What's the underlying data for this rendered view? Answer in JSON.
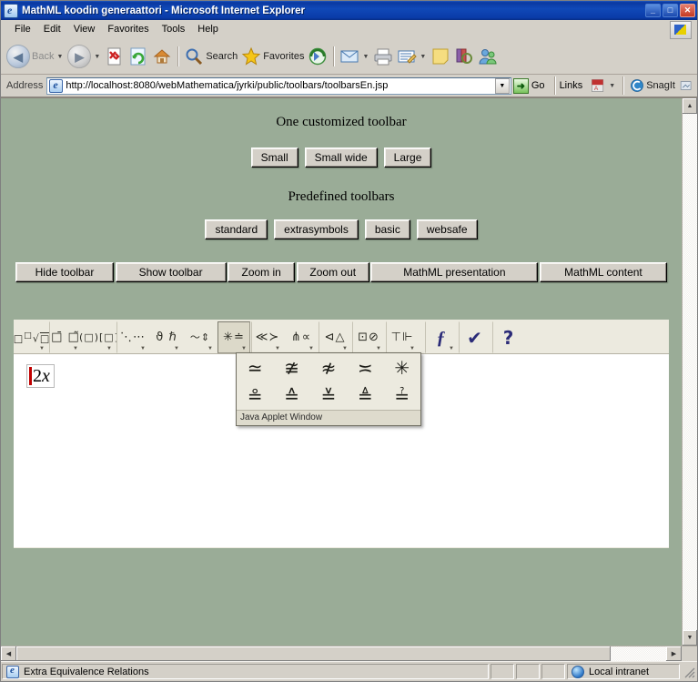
{
  "window": {
    "title": "MathML koodin generaattori - Microsoft Internet Explorer",
    "minimize_label": "_",
    "maximize_label": "□",
    "close_label": "✕"
  },
  "menu": {
    "items": [
      "File",
      "Edit",
      "View",
      "Favorites",
      "Tools",
      "Help"
    ]
  },
  "toolbar": {
    "back_label": "Back",
    "search_label": "Search",
    "favorites_label": "Favorites"
  },
  "address": {
    "label": "Address",
    "url": "http://localhost:8080/webMathematica/jyrki/public/toolbars/toolbarsEn.jsp",
    "go_label": "Go",
    "links_label": "Links",
    "snagit_label": "SnagIt"
  },
  "page": {
    "heading_custom": "One customized toolbar",
    "custom_buttons": [
      "Small",
      "Small wide",
      "Large"
    ],
    "heading_predefined": "Predefined toolbars",
    "predefined_buttons": [
      "standard",
      "extrasymbols",
      "basic",
      "websafe"
    ],
    "action_buttons": [
      "Hide toolbar",
      "Show toolbar",
      "Zoom in",
      "Zoom out",
      "MathML presentation",
      "MathML content"
    ]
  },
  "applet": {
    "palette_buttons": [
      {
        "glyph": "□□√□",
        "name": "powers-roots",
        "has_arrow": true
      },
      {
        "glyph": "□̄ □̃",
        "name": "accents",
        "has_arrow": true
      },
      {
        "glyph": "(□) [□]",
        "name": "brackets",
        "has_arrow": true
      },
      {
        "glyph": "⋱ ⋯",
        "name": "dots-matrices",
        "has_arrow": true
      },
      {
        "glyph": "ϑ ℏ",
        "name": "greek-letters",
        "has_arrow": true
      },
      {
        "glyph": "〜 ⇕",
        "name": "arrows-squiggles",
        "has_arrow": true
      },
      {
        "glyph": "✳ ≐",
        "name": "equivalence-relations",
        "has_arrow": true,
        "active": true
      },
      {
        "glyph": "≪ ≻",
        "name": "order-relations",
        "has_arrow": true
      },
      {
        "glyph": "⋔ ∝",
        "name": "misc-relations",
        "has_arrow": true
      },
      {
        "glyph": "⊲ △",
        "name": "triangle-relations",
        "has_arrow": true
      },
      {
        "glyph": "⊡ ⊘",
        "name": "box-circle-operators",
        "has_arrow": true
      },
      {
        "glyph": "⊤ ⊩",
        "name": "logic-symbols",
        "has_arrow": true
      },
      {
        "glyph": "ƒ",
        "name": "function-tools",
        "has_arrow": true,
        "blue": true
      },
      {
        "glyph": "✔",
        "name": "check-syntax",
        "has_arrow": false,
        "blue": true
      },
      {
        "glyph": "?",
        "name": "help",
        "has_arrow": false,
        "blue": true
      }
    ],
    "expression": "2x",
    "popup": {
      "symbols": [
        "≃",
        "≇",
        "≉",
        "≍",
        "✳",
        "≗",
        "≙",
        "≚",
        "≜",
        "≟"
      ],
      "footer": "Java Applet Window"
    }
  },
  "status": {
    "message": "Extra Equivalence Relations",
    "zone": "Local intranet"
  },
  "scroll": {
    "up_arrow": "▲",
    "down_arrow": "▼",
    "left_arrow": "◀",
    "right_arrow": "▶"
  },
  "colors": {
    "page_bg": "#9aac97",
    "chrome": "#d4d0c8",
    "title_blue": "#0a38a0",
    "applet_bg": "#eceadf",
    "caret_red": "#c00000",
    "icon_blue": "#2b2b78"
  }
}
